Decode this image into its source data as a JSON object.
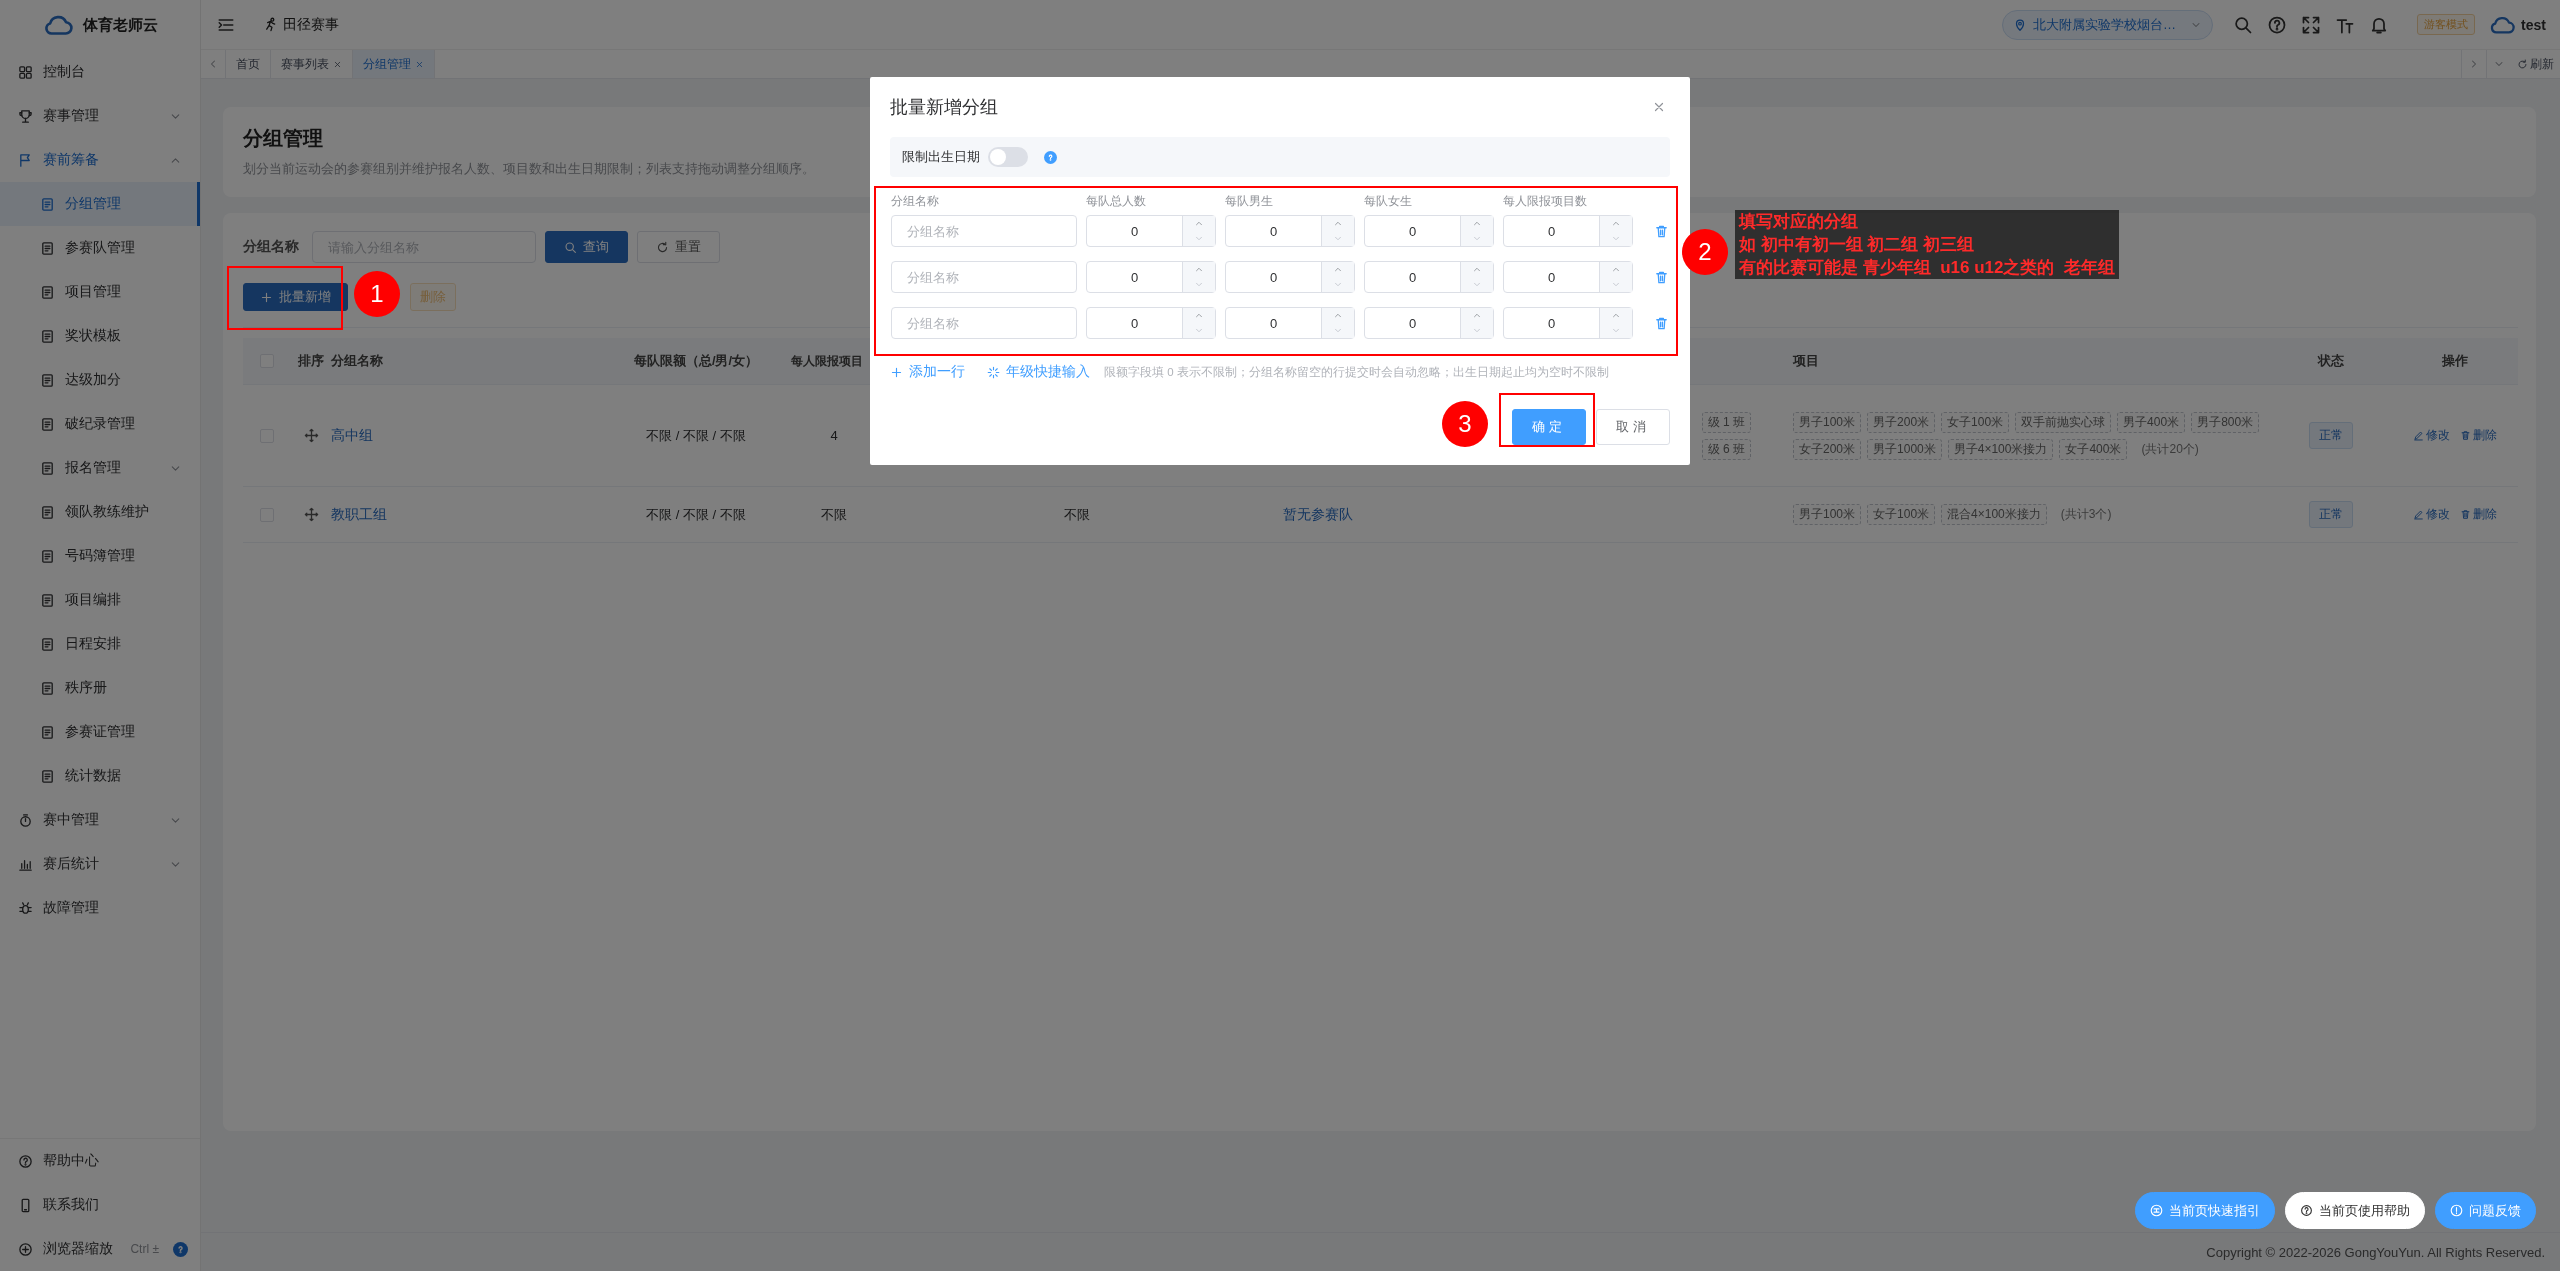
{
  "sidebar": {
    "brand": "体育老师云",
    "items": [
      {
        "label": "控制台",
        "kind": "link",
        "selected": false
      },
      {
        "label": "赛事管理",
        "kind": "group",
        "selected": false,
        "expanded": false
      },
      {
        "label": "赛前筹备",
        "kind": "group",
        "selected": true,
        "expanded": true,
        "children": [
          {
            "label": "分组管理",
            "kind": "link",
            "selected": true
          },
          {
            "label": "参赛队管理",
            "kind": "link",
            "selected": false
          },
          {
            "label": "项目管理",
            "kind": "link",
            "selected": false
          },
          {
            "label": "奖状模板",
            "kind": "link",
            "selected": false
          },
          {
            "label": "达级加分",
            "kind": "link",
            "selected": false
          },
          {
            "label": "破纪录管理",
            "kind": "link",
            "selected": false
          },
          {
            "label": "报名管理",
            "kind": "group",
            "selected": false,
            "expanded": false
          },
          {
            "label": "领队教练维护",
            "kind": "link",
            "selected": false
          },
          {
            "label": "号码簿管理",
            "kind": "link",
            "selected": false
          },
          {
            "label": "项目编排",
            "kind": "link",
            "selected": false
          },
          {
            "label": "日程安排",
            "kind": "link",
            "selected": false
          },
          {
            "label": "秩序册",
            "kind": "link",
            "selected": false
          },
          {
            "label": "参赛证管理",
            "kind": "link",
            "selected": false
          },
          {
            "label": "统计数据",
            "kind": "link",
            "selected": false
          }
        ]
      },
      {
        "label": "赛中管理",
        "kind": "group",
        "selected": false,
        "expanded": false
      },
      {
        "label": "赛后统计",
        "kind": "group",
        "selected": false,
        "expanded": false
      },
      {
        "label": "故障管理",
        "kind": "link",
        "selected": false
      }
    ],
    "bottom": [
      {
        "label": "帮助中心"
      },
      {
        "label": "联系我们"
      },
      {
        "label": "浏览器缩放",
        "shortcut": "Ctrl ±"
      }
    ]
  },
  "topbar": {
    "section": "田径赛事",
    "school": "北大附属实验学校烟台…",
    "mode_badge": "游客模式",
    "user": "test"
  },
  "tabs": [
    {
      "label": "首页",
      "selected": false,
      "closable": false
    },
    {
      "label": "赛事列表",
      "selected": false,
      "closable": true
    },
    {
      "label": "分组管理",
      "selected": true,
      "closable": true
    }
  ],
  "refresh": "刷新",
  "page": {
    "title": "分组管理",
    "description": "划分当前运动会的参赛组别并维护报名人数、项目数和出生日期限制；列表支持拖动调整分组顺序。"
  },
  "filter": {
    "label": "分组名称",
    "placeholder": "请输入分组名称",
    "search_button": "查询",
    "reset_button": "重置"
  },
  "actions": [
    {
      "label": "批量新增",
      "disabled": false
    },
    {
      "label": "删除",
      "disabled": true
    }
  ],
  "table": {
    "all_checked": false,
    "columns": {
      "order": "排序",
      "name": "分组名称",
      "quota": "每队限额（总/男/女）",
      "per_person_limit": "每人限报项目",
      "events": "项目",
      "status": "状态",
      "actions": "操作"
    },
    "rows": [
      {
        "checked": false,
        "name": "高中组",
        "quota": "不限 / 不限 / 不限",
        "per_person_limit": "4",
        "column_7_tags": [
          "级 1 班",
          "级 6 班"
        ],
        "events": [
          "男子100米",
          "男子200米",
          "女子100米",
          "双手前抛实心球",
          "男子400米",
          "男子800米",
          "女子200米",
          "男子1000米",
          "男子4×100米接力",
          "女子400米"
        ],
        "events_total": "(共计20个)",
        "status": "正常",
        "actions": [
          "修改",
          "删除"
        ]
      },
      {
        "checked": false,
        "name": "教职工组",
        "quota": "不限 / 不限 / 不限",
        "per_person_limit": "不限",
        "column_6": "不限",
        "column_7": "暂无参赛队",
        "events": [
          "男子100米",
          "女子100米",
          "混合4×100米接力"
        ],
        "events_total": "(共计3个)",
        "status": "正常",
        "actions": [
          "修改",
          "删除"
        ]
      }
    ]
  },
  "modal": {
    "title": "批量新增分组",
    "birth_limit": {
      "label": "限制出生日期",
      "on": false
    },
    "columns": [
      "分组名称",
      "每队总人数",
      "每队男生",
      "每队女生",
      "每人限报项目数"
    ],
    "rows": [
      {
        "placeholder": "分组名称",
        "values": [
          "0",
          "0",
          "0",
          "0"
        ]
      },
      {
        "placeholder": "分组名称",
        "values": [
          "0",
          "0",
          "0",
          "0"
        ]
      },
      {
        "placeholder": "分组名称",
        "values": [
          "0",
          "0",
          "0",
          "0"
        ]
      }
    ],
    "add_row": "添加一行",
    "grade_input": "年级快捷输入",
    "hint": "限额字段填 0 表示不限制；分组名称留空的行提交时会自动忽略；出生日期起止均为空时不限制",
    "confirm": "确定",
    "cancel": "取消"
  },
  "annotations": {
    "markers": [
      "1",
      "2",
      "3"
    ],
    "note": [
      "填写对应的分组",
      "如 初中有初一组 初二组 初三组",
      "有的比赛可能是 青少年组  u16 u12之类的  老年组"
    ]
  },
  "help_buttons": [
    {
      "label": "当前页快速指引",
      "kind": "primary"
    },
    {
      "label": "当前页使用帮助",
      "kind": "plain"
    },
    {
      "label": "问题反馈",
      "kind": "primary"
    }
  ],
  "footer": "Copyright © 2022-2026 GongYouYun. All Rights Reserved."
}
